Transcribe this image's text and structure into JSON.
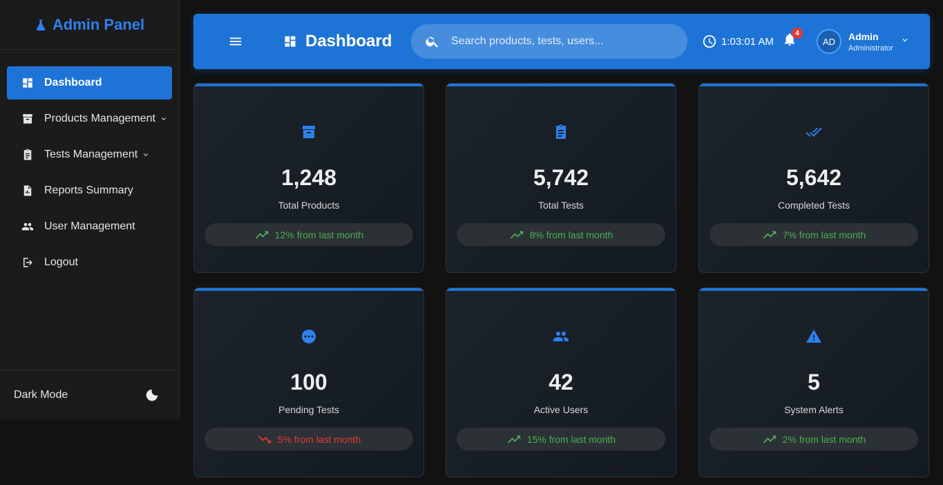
{
  "brand": {
    "title": "Admin Panel",
    "icon": "flask-icon"
  },
  "sidebar": {
    "items": [
      {
        "label": "Dashboard",
        "icon": "dashboard-icon",
        "active": true
      },
      {
        "label": "Products Management",
        "icon": "archive-icon",
        "has_submenu": true
      },
      {
        "label": "Tests Management",
        "icon": "clipboard-icon",
        "has_submenu": true
      },
      {
        "label": "Reports Summary",
        "icon": "report-icon"
      },
      {
        "label": "User Management",
        "icon": "users-icon"
      },
      {
        "label": "Logout",
        "icon": "logout-icon"
      }
    ],
    "footer": {
      "label": "Dark Mode",
      "icon": "moon-icon"
    }
  },
  "header": {
    "title": "Dashboard",
    "search_placeholder": "Search products, tests, users...",
    "time": "1:03:01 AM",
    "notifications_count": "4",
    "user": {
      "initials": "AD",
      "name": "Admin",
      "role": "Administrator"
    }
  },
  "stats": [
    {
      "icon": "archive-icon",
      "value": "1,248",
      "label": "Total Products",
      "trend": "12% from last month",
      "direction": "up"
    },
    {
      "icon": "clipboard-icon",
      "value": "5,742",
      "label": "Total Tests",
      "trend": "8% from last month",
      "direction": "up"
    },
    {
      "icon": "double-check-icon",
      "value": "5,642",
      "label": "Completed Tests",
      "trend": "7% from last month",
      "direction": "up"
    },
    {
      "icon": "pending-icon",
      "value": "100",
      "label": "Pending Tests",
      "trend": "5% from last month",
      "direction": "down"
    },
    {
      "icon": "users-icon",
      "value": "42",
      "label": "Active Users",
      "trend": "15% from last month",
      "direction": "up"
    },
    {
      "icon": "warning-icon",
      "value": "5",
      "label": "System Alerts",
      "trend": "2% from last month",
      "direction": "up"
    }
  ],
  "colors": {
    "accent": "#1e74d6",
    "up": "#4caf50",
    "down": "#e53935",
    "background": "#121212"
  }
}
